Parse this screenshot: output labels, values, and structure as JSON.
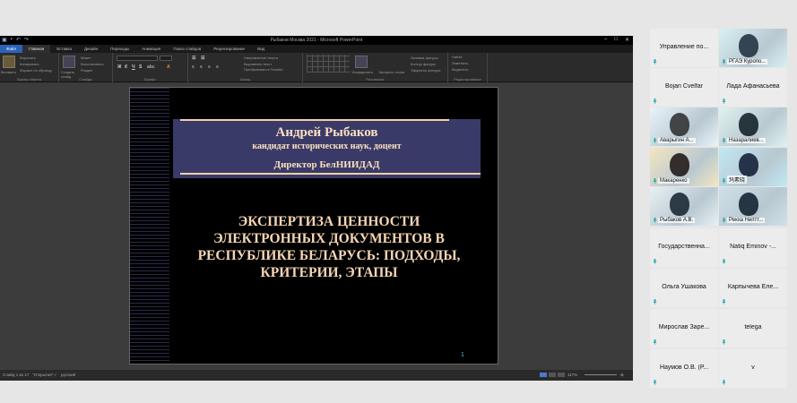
{
  "window": {
    "title": "Рыбаков Москва 2021 - Microsoft PowerPoint"
  },
  "ribbon": {
    "tabs": [
      {
        "label": "Файл"
      },
      {
        "label": "Главная"
      },
      {
        "label": "Вставка"
      },
      {
        "label": "Дизайн"
      },
      {
        "label": "Переходы"
      },
      {
        "label": "Анимация"
      },
      {
        "label": "Показ слайдов"
      },
      {
        "label": "Рецензирование"
      },
      {
        "label": "Вид"
      }
    ],
    "groups": {
      "clipboard": {
        "label": "Буфер обмена",
        "paste": "Вставить",
        "cut": "Вырезать",
        "copy": "Копировать",
        "format": "Формат по образцу"
      },
      "slides": {
        "label": "Слайды",
        "new_slide": "Создать слайд",
        "layout": "Макет",
        "reset": "Восстановить",
        "section": "Раздел"
      },
      "font": {
        "label": "Шрифт"
      },
      "paragraph": {
        "label": "Абзац",
        "direction": "Направление текста",
        "align": "Выровнять текст",
        "smartart": "Преобразовать в SmartArt"
      },
      "drawing": {
        "label": "Рисование",
        "arrange": "Упорядочить",
        "styles": "Экспресс-стили",
        "fill": "Заливка фигуры",
        "outline": "Контур фигуры",
        "effects": "Эффекты фигуры"
      },
      "editing": {
        "label": "Редактирование",
        "find": "Найти",
        "replace": "Заменить",
        "select": "Выделить"
      }
    }
  },
  "slide": {
    "author": "Андрей Рыбаков",
    "degree": "кандидат исторических наук, доцент",
    "director": "Директор БелНИИДАД",
    "title_lines": [
      "ЭКСПЕРТИЗА ЦЕННОСТИ",
      "ЭЛЕКТРОННЫХ ДОКУМЕНТОВ В",
      "РЕСПУБЛИКЕ БЕЛАРУСЬ: ПОДХОДЫ,",
      "КРИТЕРИИ, ЭТАПЫ"
    ],
    "number": "1"
  },
  "statusbar": {
    "slide_info": "Слайд 1 из 17",
    "theme": "\"Открытая\"",
    "language": "русский",
    "zoom": "117%"
  },
  "participants": [
    {
      "name": "Управление по...",
      "video": false
    },
    {
      "name": "РГАЭ Куропо...",
      "video": true
    },
    {
      "name": "Bojan Cvelfar",
      "video": false
    },
    {
      "name": "Лада Афанасьева",
      "video": false
    },
    {
      "name": "Аварыгин А...",
      "video": true
    },
    {
      "name": "Назаралиев...",
      "video": true
    },
    {
      "name": "Макаренко",
      "video": true
    },
    {
      "name": "玛素晓",
      "video": true
    },
    {
      "name": "Рыбаков А.В.",
      "video": true,
      "active": true
    },
    {
      "name": "Рекха Нептт...",
      "video": true
    },
    {
      "name": "Государственна...",
      "video": false
    },
    {
      "name": "Natiq Eminov -...",
      "video": false
    },
    {
      "name": "Ольга Ушакова",
      "video": false
    },
    {
      "name": "Карпычева Еле...",
      "video": false
    },
    {
      "name": "Мирослав Заре...",
      "video": false
    },
    {
      "name": "telega",
      "video": false
    },
    {
      "name": "Наумов О.В. (Р...",
      "video": false
    },
    {
      "name": "v",
      "video": false
    }
  ],
  "colors": {
    "slide_banner": "#3a3a68",
    "slide_text": "#f5d6b4",
    "file_tab": "#2a63b8",
    "mic_icon": "#2aa6a6",
    "active_speaker": "#3a3ad8"
  }
}
